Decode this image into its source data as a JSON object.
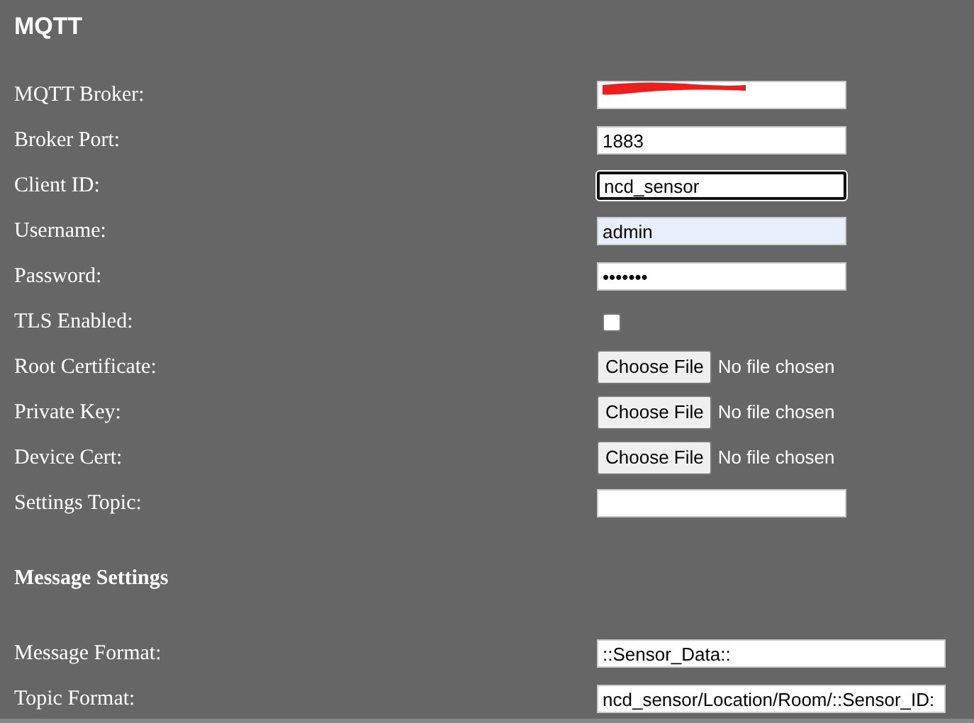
{
  "title": "MQTT",
  "rows": [
    {
      "kind": "text",
      "label": "MQTT Broker:",
      "redacted": true,
      "focused": false,
      "autofilled": false
    },
    {
      "kind": "text",
      "label": "Broker Port:",
      "value": "1883",
      "focused": false,
      "autofilled": false
    },
    {
      "kind": "text",
      "label": "Client ID:",
      "value": "ncd_sensor",
      "focused": true,
      "autofilled": false
    },
    {
      "kind": "text",
      "label": "Username:",
      "value": "admin",
      "focused": false,
      "autofilled": true
    },
    {
      "kind": "text",
      "label": "Password:",
      "value": "•••••••",
      "focused": false,
      "autofilled": false
    },
    {
      "kind": "checkbox",
      "label": "TLS Enabled:",
      "checked": false
    },
    {
      "kind": "file",
      "label": "Root Certificate:",
      "button": "Choose File",
      "status": "No file chosen"
    },
    {
      "kind": "file",
      "label": "Private Key:",
      "button": "Choose File",
      "status": "No file chosen"
    },
    {
      "kind": "file",
      "label": "Device Cert:",
      "button": "Choose File",
      "status": "No file chosen"
    },
    {
      "kind": "text",
      "label": "Settings Topic:",
      "focused": false,
      "autofilled": false
    },
    {
      "kind": "heading",
      "label": "Message Settings"
    },
    {
      "kind": "wide",
      "label": "Message Format:",
      "value": "::Sensor_Data::"
    },
    {
      "kind": "wide",
      "label": "Topic Format:",
      "value": "ncd_sensor/Location/Room/::Sensor_ID:"
    }
  ]
}
